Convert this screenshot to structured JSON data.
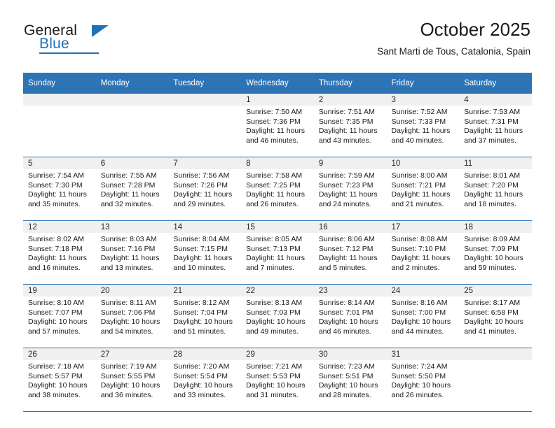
{
  "brand": {
    "name_part1": "General",
    "name_part2": "Blue",
    "accent_color": "#1f72b8"
  },
  "header": {
    "title": "October 2025",
    "subtitle": "Sant Marti de Tous, Catalonia, Spain",
    "header_bg_color": "#2d74b5",
    "daynum_bg_color": "#f0f0f0"
  },
  "weekdays": [
    "Sunday",
    "Monday",
    "Tuesday",
    "Wednesday",
    "Thursday",
    "Friday",
    "Saturday"
  ],
  "labels": {
    "sunrise_prefix": "Sunrise: ",
    "sunset_prefix": "Sunset: ",
    "daylight_prefix": "Daylight: "
  },
  "weeks": [
    [
      {
        "day": "",
        "empty": true
      },
      {
        "day": "",
        "empty": true
      },
      {
        "day": "",
        "empty": true
      },
      {
        "day": "1",
        "sunrise": "Sunrise: 7:50 AM",
        "sunset": "Sunset: 7:36 PM",
        "daylight_line1": "Daylight: 11 hours",
        "daylight_line2": "and 46 minutes."
      },
      {
        "day": "2",
        "sunrise": "Sunrise: 7:51 AM",
        "sunset": "Sunset: 7:35 PM",
        "daylight_line1": "Daylight: 11 hours",
        "daylight_line2": "and 43 minutes."
      },
      {
        "day": "3",
        "sunrise": "Sunrise: 7:52 AM",
        "sunset": "Sunset: 7:33 PM",
        "daylight_line1": "Daylight: 11 hours",
        "daylight_line2": "and 40 minutes."
      },
      {
        "day": "4",
        "sunrise": "Sunrise: 7:53 AM",
        "sunset": "Sunset: 7:31 PM",
        "daylight_line1": "Daylight: 11 hours",
        "daylight_line2": "and 37 minutes."
      }
    ],
    [
      {
        "day": "5",
        "sunrise": "Sunrise: 7:54 AM",
        "sunset": "Sunset: 7:30 PM",
        "daylight_line1": "Daylight: 11 hours",
        "daylight_line2": "and 35 minutes."
      },
      {
        "day": "6",
        "sunrise": "Sunrise: 7:55 AM",
        "sunset": "Sunset: 7:28 PM",
        "daylight_line1": "Daylight: 11 hours",
        "daylight_line2": "and 32 minutes."
      },
      {
        "day": "7",
        "sunrise": "Sunrise: 7:56 AM",
        "sunset": "Sunset: 7:26 PM",
        "daylight_line1": "Daylight: 11 hours",
        "daylight_line2": "and 29 minutes."
      },
      {
        "day": "8",
        "sunrise": "Sunrise: 7:58 AM",
        "sunset": "Sunset: 7:25 PM",
        "daylight_line1": "Daylight: 11 hours",
        "daylight_line2": "and 26 minutes."
      },
      {
        "day": "9",
        "sunrise": "Sunrise: 7:59 AM",
        "sunset": "Sunset: 7:23 PM",
        "daylight_line1": "Daylight: 11 hours",
        "daylight_line2": "and 24 minutes."
      },
      {
        "day": "10",
        "sunrise": "Sunrise: 8:00 AM",
        "sunset": "Sunset: 7:21 PM",
        "daylight_line1": "Daylight: 11 hours",
        "daylight_line2": "and 21 minutes."
      },
      {
        "day": "11",
        "sunrise": "Sunrise: 8:01 AM",
        "sunset": "Sunset: 7:20 PM",
        "daylight_line1": "Daylight: 11 hours",
        "daylight_line2": "and 18 minutes."
      }
    ],
    [
      {
        "day": "12",
        "sunrise": "Sunrise: 8:02 AM",
        "sunset": "Sunset: 7:18 PM",
        "daylight_line1": "Daylight: 11 hours",
        "daylight_line2": "and 16 minutes."
      },
      {
        "day": "13",
        "sunrise": "Sunrise: 8:03 AM",
        "sunset": "Sunset: 7:16 PM",
        "daylight_line1": "Daylight: 11 hours",
        "daylight_line2": "and 13 minutes."
      },
      {
        "day": "14",
        "sunrise": "Sunrise: 8:04 AM",
        "sunset": "Sunset: 7:15 PM",
        "daylight_line1": "Daylight: 11 hours",
        "daylight_line2": "and 10 minutes."
      },
      {
        "day": "15",
        "sunrise": "Sunrise: 8:05 AM",
        "sunset": "Sunset: 7:13 PM",
        "daylight_line1": "Daylight: 11 hours",
        "daylight_line2": "and 7 minutes."
      },
      {
        "day": "16",
        "sunrise": "Sunrise: 8:06 AM",
        "sunset": "Sunset: 7:12 PM",
        "daylight_line1": "Daylight: 11 hours",
        "daylight_line2": "and 5 minutes."
      },
      {
        "day": "17",
        "sunrise": "Sunrise: 8:08 AM",
        "sunset": "Sunset: 7:10 PM",
        "daylight_line1": "Daylight: 11 hours",
        "daylight_line2": "and 2 minutes."
      },
      {
        "day": "18",
        "sunrise": "Sunrise: 8:09 AM",
        "sunset": "Sunset: 7:09 PM",
        "daylight_line1": "Daylight: 10 hours",
        "daylight_line2": "and 59 minutes."
      }
    ],
    [
      {
        "day": "19",
        "sunrise": "Sunrise: 8:10 AM",
        "sunset": "Sunset: 7:07 PM",
        "daylight_line1": "Daylight: 10 hours",
        "daylight_line2": "and 57 minutes."
      },
      {
        "day": "20",
        "sunrise": "Sunrise: 8:11 AM",
        "sunset": "Sunset: 7:06 PM",
        "daylight_line1": "Daylight: 10 hours",
        "daylight_line2": "and 54 minutes."
      },
      {
        "day": "21",
        "sunrise": "Sunrise: 8:12 AM",
        "sunset": "Sunset: 7:04 PM",
        "daylight_line1": "Daylight: 10 hours",
        "daylight_line2": "and 51 minutes."
      },
      {
        "day": "22",
        "sunrise": "Sunrise: 8:13 AM",
        "sunset": "Sunset: 7:03 PM",
        "daylight_line1": "Daylight: 10 hours",
        "daylight_line2": "and 49 minutes."
      },
      {
        "day": "23",
        "sunrise": "Sunrise: 8:14 AM",
        "sunset": "Sunset: 7:01 PM",
        "daylight_line1": "Daylight: 10 hours",
        "daylight_line2": "and 46 minutes."
      },
      {
        "day": "24",
        "sunrise": "Sunrise: 8:16 AM",
        "sunset": "Sunset: 7:00 PM",
        "daylight_line1": "Daylight: 10 hours",
        "daylight_line2": "and 44 minutes."
      },
      {
        "day": "25",
        "sunrise": "Sunrise: 8:17 AM",
        "sunset": "Sunset: 6:58 PM",
        "daylight_line1": "Daylight: 10 hours",
        "daylight_line2": "and 41 minutes."
      }
    ],
    [
      {
        "day": "26",
        "sunrise": "Sunrise: 7:18 AM",
        "sunset": "Sunset: 5:57 PM",
        "daylight_line1": "Daylight: 10 hours",
        "daylight_line2": "and 38 minutes."
      },
      {
        "day": "27",
        "sunrise": "Sunrise: 7:19 AM",
        "sunset": "Sunset: 5:55 PM",
        "daylight_line1": "Daylight: 10 hours",
        "daylight_line2": "and 36 minutes."
      },
      {
        "day": "28",
        "sunrise": "Sunrise: 7:20 AM",
        "sunset": "Sunset: 5:54 PM",
        "daylight_line1": "Daylight: 10 hours",
        "daylight_line2": "and 33 minutes."
      },
      {
        "day": "29",
        "sunrise": "Sunrise: 7:21 AM",
        "sunset": "Sunset: 5:53 PM",
        "daylight_line1": "Daylight: 10 hours",
        "daylight_line2": "and 31 minutes."
      },
      {
        "day": "30",
        "sunrise": "Sunrise: 7:23 AM",
        "sunset": "Sunset: 5:51 PM",
        "daylight_line1": "Daylight: 10 hours",
        "daylight_line2": "and 28 minutes."
      },
      {
        "day": "31",
        "sunrise": "Sunrise: 7:24 AM",
        "sunset": "Sunset: 5:50 PM",
        "daylight_line1": "Daylight: 10 hours",
        "daylight_line2": "and 26 minutes."
      },
      {
        "day": "",
        "empty": true
      }
    ]
  ]
}
